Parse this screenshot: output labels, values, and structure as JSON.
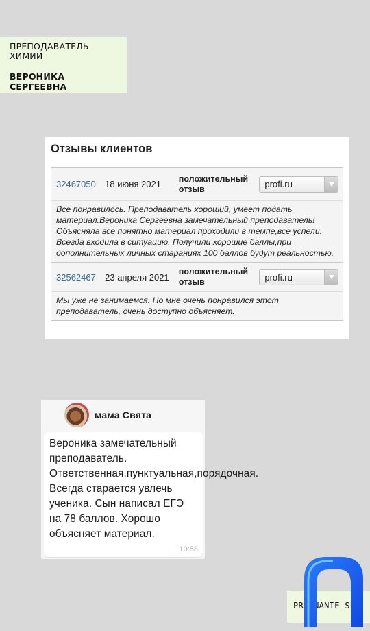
{
  "teacher": {
    "role": "ПРЕПОДАВАТЕЛЬ ХИМИИ",
    "name": "ВЕРОНИКА СЕРГЕЕВНА"
  },
  "reviews": {
    "title": "Отзывы клиентов",
    "items": [
      {
        "id": "32467050",
        "date": "18 июня 2021",
        "type": "положительный отзыв",
        "source": "profi.ru",
        "text": "Все понравилось. Преподаватель хороший, умеет подать материал.Вероника Сергеевна замечательный преподаватель! Объясняла все понятно,материал проходили в темпе,все успели. Всегда входила в ситуацию. Получили хорошие баллы,при дополнительных личных стараниях 100 баллов будут реальностью."
      },
      {
        "id": "32562467",
        "date": "23 апреля 2021",
        "type": "положительный отзыв",
        "source": "profi.ru",
        "text": "Мы уже не занимаемся. Но мне очень понравился этот преподаватель, очень доступно объясняет."
      }
    ]
  },
  "chat": {
    "sender": "мама Свята",
    "message": "Вероника замечательный преподаватель. Ответственная,пунктуальная,порядочная. Всегда старается увлечь ученика. Сын написал ЕГЭ на 78 баллов.  Хорошо объясняет материал.",
    "time": "10:58"
  },
  "brand": {
    "text": "PROFNANIE_SPB",
    "logo_icon": "blue-arch-logo-icon"
  },
  "colors": {
    "background": "#d9d9d9",
    "card_green": "#eef7e0",
    "link_blue": "#3a6b9a",
    "logo_blue": "#1f6bff"
  }
}
